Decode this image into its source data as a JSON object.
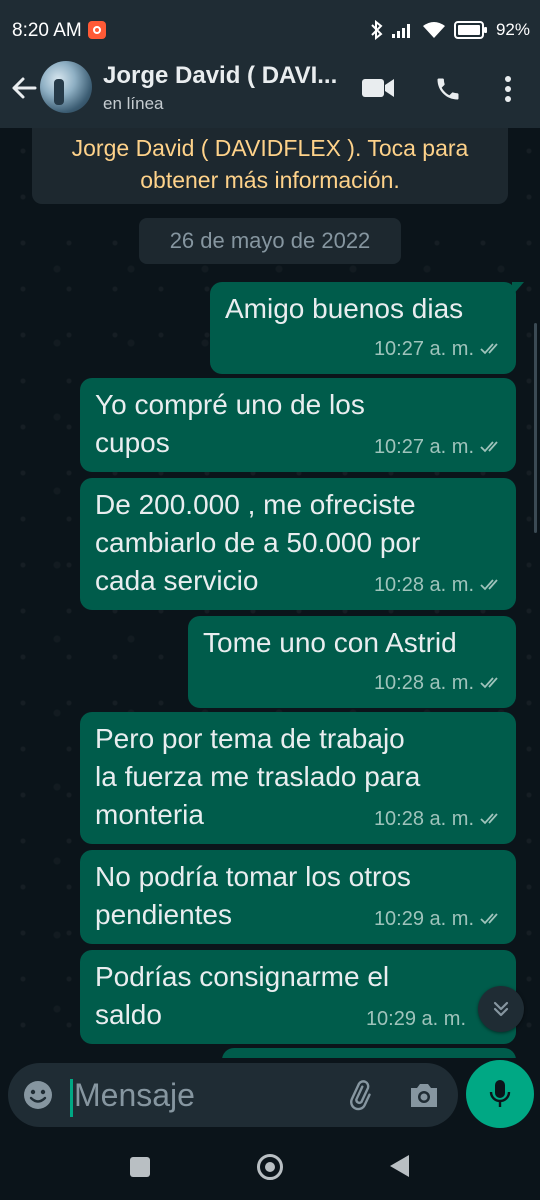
{
  "status_bar": {
    "time": "8:20 AM",
    "battery_percent": "92%",
    "icons": [
      "notification-icon",
      "bluetooth-icon",
      "signal-icon",
      "wifi-icon",
      "battery-icon"
    ]
  },
  "header": {
    "contact_name": "Jorge David ( DAVI...",
    "status": "en línea",
    "icons": [
      "back-arrow-icon",
      "video-call-icon",
      "phone-icon",
      "more-vert-icon"
    ]
  },
  "chat": {
    "system_message": "Jorge David ( DAVIDFLEX ). Toca para\nobtener más información.",
    "date_label": "26 de mayo de 2022",
    "messages": [
      {
        "text": "Amigo buenos dias",
        "time": "10:27 a. m."
      },
      {
        "text": "Yo compré uno de los\ncupos",
        "time": "10:27 a. m."
      },
      {
        "text": "De 200.000 , me ofreciste\ncambiarlo de a 50.000 por\ncada servicio",
        "time": "10:28 a. m."
      },
      {
        "text": "Tome uno con Astrid",
        "time": "10:28 a. m."
      },
      {
        "text": "Pero por tema de trabajo\nla fuerza me traslado para\nmonteria",
        "time": "10:28 a. m."
      },
      {
        "text": "No podría tomar los otros\npendientes",
        "time": "10:29 a. m."
      },
      {
        "text": "Podrías consignarme el\nsaldo",
        "time": "10:29 a. m."
      }
    ]
  },
  "composer": {
    "placeholder": "Mensaje"
  },
  "colors": {
    "outgoing_bubble": "#005c4b",
    "header": "#1f2c34",
    "accent": "#00a884",
    "system_text": "#fed28a"
  }
}
